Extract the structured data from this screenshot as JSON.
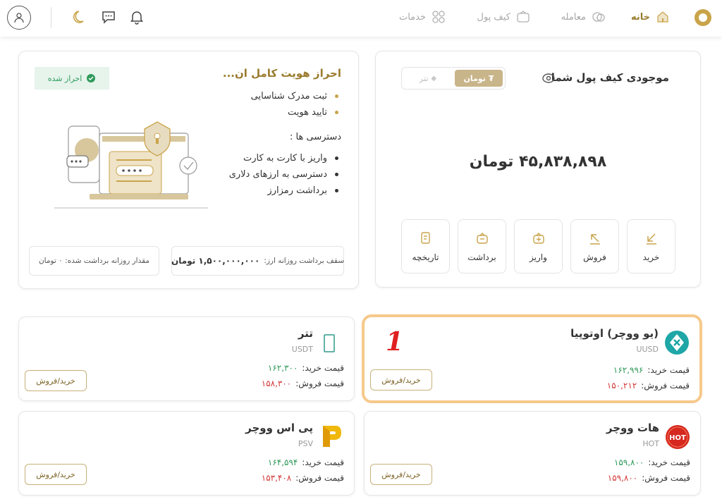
{
  "nav": {
    "items": [
      {
        "label": "خانه",
        "icon": "home-icon",
        "active": true
      },
      {
        "label": "معامله",
        "icon": "trade-icon",
        "active": false
      },
      {
        "label": "کیف پول",
        "icon": "wallet-icon",
        "active": false
      },
      {
        "label": "خدمات",
        "icon": "grid-icon",
        "active": false
      }
    ],
    "icons": [
      "bell-icon",
      "chat-icon",
      "moon-icon",
      "user-icon"
    ]
  },
  "wallet": {
    "title": "موجودی کیف پول شما",
    "toggle": {
      "active": "تومان",
      "other": "تتر"
    },
    "balance": "۴۵,۸۳۸,۸۹۸  تومان",
    "actions": [
      {
        "label": "خرید",
        "icon": "buy-arrow-icon"
      },
      {
        "label": "فروش",
        "icon": "sell-arrow-icon"
      },
      {
        "label": "واریز",
        "icon": "deposit-icon"
      },
      {
        "label": "برداشت",
        "icon": "withdraw-icon"
      },
      {
        "label": "تاریخچه",
        "icon": "history-icon"
      }
    ]
  },
  "kyc": {
    "title": "احراز هویت کامل ان...",
    "status": "احراز شده",
    "steps": [
      "ثبت مدرک شناسایی",
      "تایید هویت"
    ],
    "access_title": "دسترسی ها :",
    "access": [
      "واریز با کارت به کارت",
      "دسترسی به ارزهای دلاری",
      "برداشت رمزارز"
    ],
    "limit_label": "سقف برداشت روزانه ارز:",
    "limit_value": "۱,۵۰۰,۰۰۰,۰۰۰ تومان",
    "withdrawn_label": "مقدار روزانه برداشت شده: ۰ تومان"
  },
  "coins": [
    {
      "name": "(یو ووچر) اوتوپیا",
      "symbol": "UUSD",
      "buy_label": "قیمت خرید:",
      "buy": "۱۶۲,۹۹۶",
      "sell_label": "قیمت فروش:",
      "sell": "۱۵۰,۲۱۲",
      "button": "خرید/فروش",
      "marker": "1"
    },
    {
      "name": "تتر",
      "symbol": "USDT",
      "buy_label": "قیمت خرید:",
      "buy": "۱۶۲,۳۰۰",
      "sell_label": "قیمت فروش:",
      "sell": "۱۵۸,۳۰۰",
      "button": "خرید/فروش"
    },
    {
      "name": "هات ووچر",
      "symbol": "HOT",
      "buy_label": "قیمت خرید:",
      "buy": "۱۵۹,۸۰۰",
      "sell_label": "قیمت فروش:",
      "sell": "۱۵۹,۸۰۰",
      "button": "خرید/فروش",
      "logo_text": "HOT"
    },
    {
      "name": "پی اس ووچر",
      "symbol": "PSV",
      "buy_label": "قیمت خرید:",
      "buy": "۱۶۴,۵۹۴",
      "sell_label": "قیمت فروش:",
      "sell": "۱۵۳,۴۰۸",
      "button": "خرید/فروش"
    }
  ],
  "colors": {
    "accent": "#9a7b2f",
    "gold": "#c9a44a",
    "buy": "#2f9a5a",
    "sell": "#d33a3a",
    "highlight": "#f6c98a"
  }
}
